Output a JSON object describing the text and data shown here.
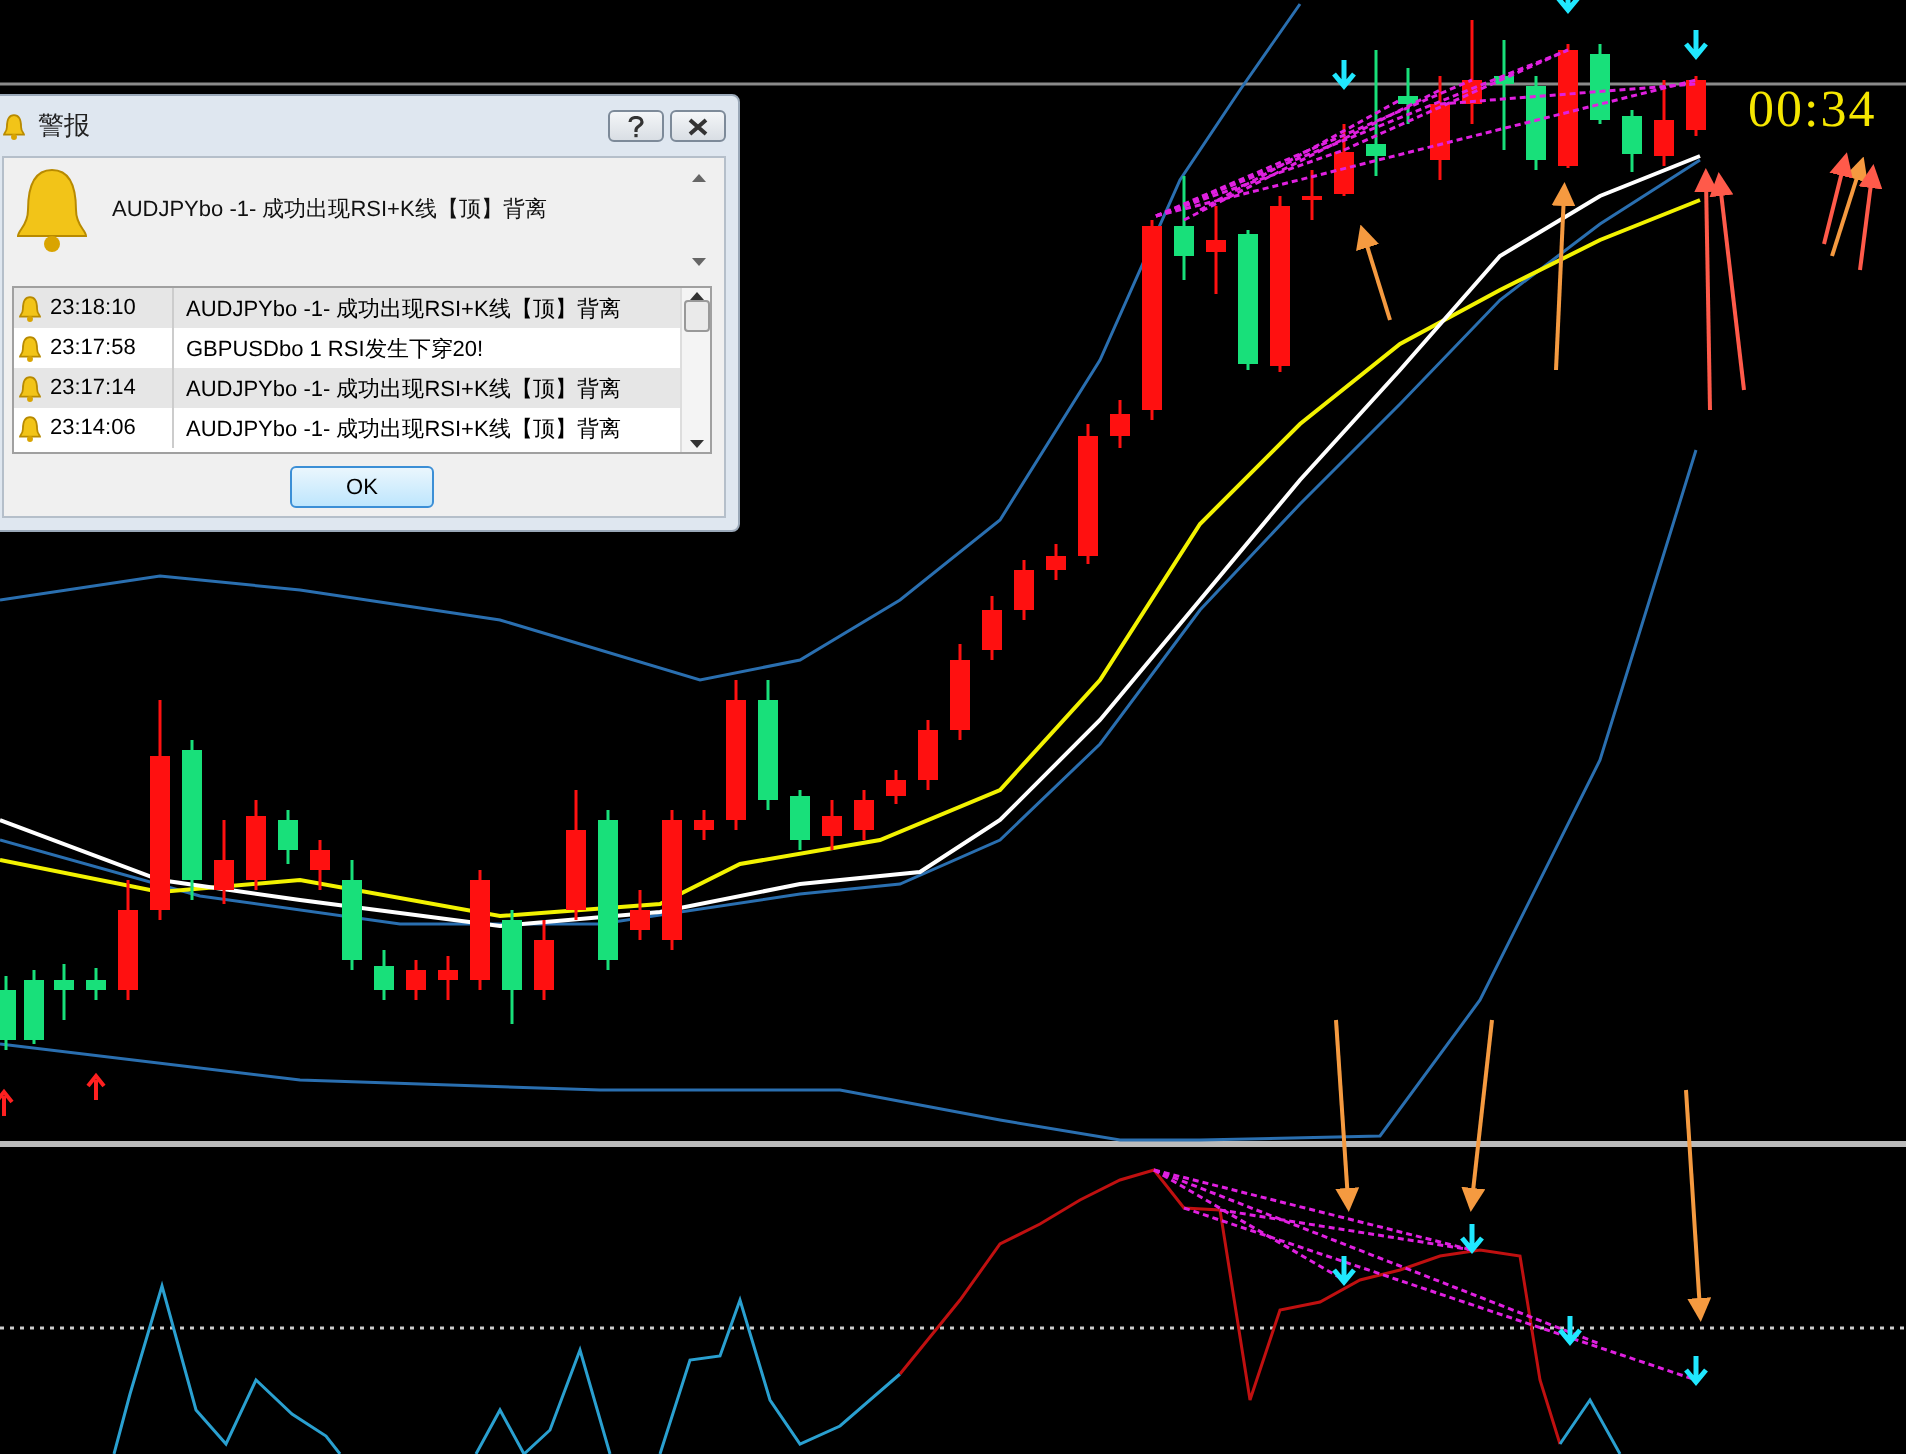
{
  "window": {
    "title": "警报"
  },
  "message": "AUDJPYbo -1- 成功出现RSI+K线【顶】背离",
  "alerts": [
    {
      "time": "23:18:10",
      "text": "AUDJPYbo -1- 成功出现RSI+K线【顶】背离"
    },
    {
      "time": "23:17:58",
      "text": "GBPUSDbo 1 RSI发生下穿20!"
    },
    {
      "time": "23:17:14",
      "text": "AUDJPYbo -1- 成功出现RSI+K线【顶】背离"
    },
    {
      "time": "23:14:06",
      "text": "AUDJPYbo -1- 成功出现RSI+K线【顶】背离"
    }
  ],
  "buttons": [
    "OK"
  ],
  "chart": {
    "countdown": "00:34"
  }
}
